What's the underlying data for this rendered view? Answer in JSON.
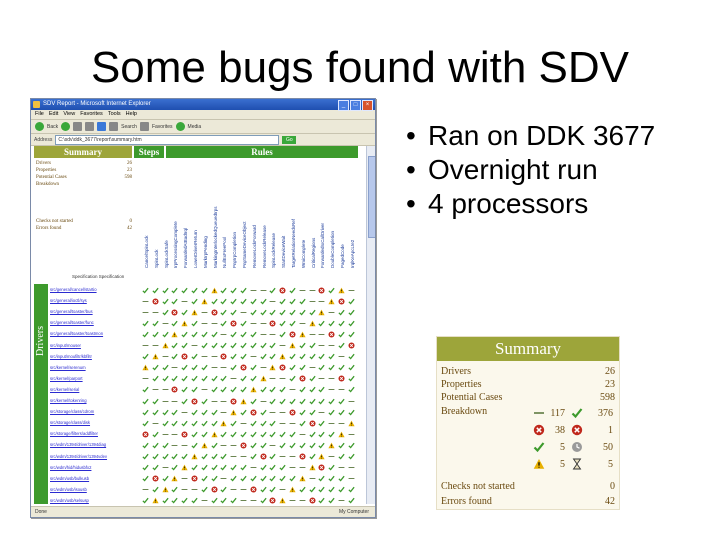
{
  "slide": {
    "title": "Some bugs found with SDV",
    "bullets": [
      "Ran on DDK 3677",
      "Overnight run",
      "4 processors"
    ]
  },
  "browser": {
    "title": "SDV Report - Microsoft Internet Explorer",
    "menu": [
      "File",
      "Edit",
      "View",
      "Favorites",
      "Tools",
      "Help"
    ],
    "toolbar": {
      "back": "Back",
      "search": "Search",
      "favorites": "Favorites",
      "media": "Media"
    },
    "address_label": "Address",
    "address": "C:\\sdv\\ddk_3677\\report\\summary.htm",
    "go": "Go",
    "status": "Done",
    "zone": "My Computer",
    "headers": {
      "summary": "Summary",
      "steps": "Steps",
      "rules": "Rules"
    },
    "side_label": "Drivers",
    "mini_summary": [
      {
        "label": "Drivers",
        "value": "26"
      },
      {
        "label": "Properties",
        "value": "23"
      },
      {
        "label": "Potential Cases",
        "value": "598"
      },
      {
        "label": "Breakdown",
        "value": ""
      },
      {
        "label": "Checks not started",
        "value": "0"
      },
      {
        "label": "Errors found",
        "value": "42"
      }
    ],
    "spec_label": "Specification Specification",
    "rule_columns": [
      "CancelSpinLock",
      "SpinLock",
      "SpinLockSafe",
      "IrpProcessingComplete",
      "ForwardedAtBadIrql",
      "LowerDriverReturn",
      "MarkIrpPending",
      "MarkingInterlockedQueuedIrps",
      "NullExFreePool",
      "PnpIrpCompletion",
      "PnpSameDeviceObject",
      "RemoveLockForward",
      "RemoveLockRelease",
      "SpinLockRelease",
      "StartDeviceWait",
      "TargetRelationNeedsRef",
      "WmiComplete",
      "CriticalRegions",
      "ForwardedIoCallDriver",
      "DoubleCompletion",
      "PagedCode",
      "IrqlKeApcLte2"
    ],
    "driver_rows": [
      "src/general/cancel/startio",
      "src/general/ioctl/sys",
      "src/general/toaster/bus",
      "src/general/toaster/func",
      "src/general/toaster/toastmon",
      "src/input/mouser",
      "src/input/moufiltr/kbfiltr",
      "src/kernel/serenum",
      "src/kernel/parport",
      "src/kernel/serial",
      "src/kernel/tokenring",
      "src/storage/class/cdrom",
      "src/storage/class/disk",
      "src/storage/filters/addfilter",
      "src/wdm/1394/driver/1394diag",
      "src/wdm/1394/driver/1394vdev",
      "src/wdm/hid/hidusbfx2",
      "src/wdm/usb/bulkusb",
      "src/wdm/usb/isousb",
      "src/wdm/usb/selsusp",
      "src/video/displays/mirror",
      "src/smartcrd/scrcp8t",
      "src/smartcrd/pscr"
    ]
  },
  "summary_panel": {
    "title": "Summary",
    "rows": [
      {
        "label": "Drivers",
        "value": "26"
      },
      {
        "label": "Properties",
        "value": "23"
      },
      {
        "label": "Potential Cases",
        "value": "598"
      },
      {
        "label": "Breakdown",
        "value": ""
      },
      {
        "label": "Checks not started",
        "value": "0"
      },
      {
        "label": "Errors found",
        "value": "42"
      }
    ],
    "breakdown": [
      {
        "left_icon": "dash-icon",
        "left_value": "117",
        "right_icon": "check-icon",
        "right_value": "376"
      },
      {
        "left_icon": "error-icon",
        "left_value": "38",
        "right_icon": "error-icon",
        "right_value": "1"
      },
      {
        "left_icon": "check-icon",
        "left_value": "5",
        "right_icon": "timeout-icon",
        "right_value": "50"
      },
      {
        "left_icon": "warning-icon",
        "left_value": "5",
        "right_icon": "hourglass-icon",
        "right_value": "5"
      }
    ],
    "colors": {
      "header": "#9da53a",
      "text": "#6a4a10",
      "check": "#3d9a2c",
      "error": "#c0281c",
      "warning": "#e8b000"
    }
  }
}
